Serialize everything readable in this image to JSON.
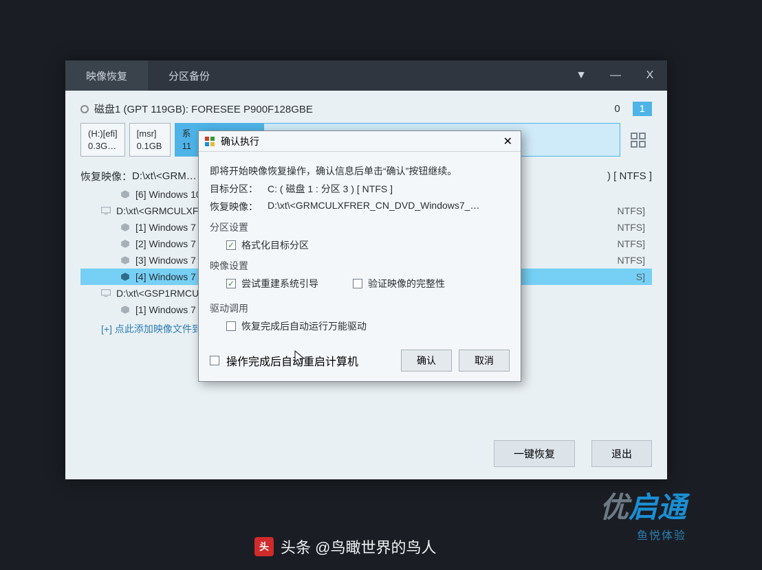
{
  "tabs": {
    "restore": "映像恢复",
    "backup": "分区备份"
  },
  "titlebar": {
    "dropdown": "▼",
    "minimize": "—",
    "close": "X"
  },
  "disk": {
    "label": "磁盘1 (GPT 119GB): FORESEE P900F128GBE",
    "num0": "0",
    "num1": "1"
  },
  "partitions": {
    "p1_line1": "(H:)[efi]",
    "p1_line2": "0.3G…",
    "p2_line1": "[msr]",
    "p2_line2": "0.1GB",
    "p3_line1": "系",
    "p3_line2": "11"
  },
  "restore_label": "恢复映像：",
  "restore_path_trail": ") [ NTFS ]",
  "tree": {
    "root1": "D:\\xt\\<GRM…",
    "r1_c1": "[6] Windows 10",
    "r1_c1_trail": "",
    "root2": "D:\\xt\\<GRMCULXFRER…",
    "r2_c1": "[1] Windows 7",
    "r2_c1_trail": "NTFS]",
    "r2_c2": "[2] Windows 7",
    "r2_c2_trail": "NTFS]",
    "r2_c3": "[3] Windows 7",
    "r2_c3_trail": "NTFS]",
    "r2_c4": "[4] Windows 7",
    "r2_c4_trail": "S]",
    "root3": "D:\\xt\\<GSP1RMCUL…",
    "r3_c1": "[1] Windows 7",
    "addlink": "[+] 点此添加映像文件到列表"
  },
  "footer": {
    "restore_btn": "一键恢复",
    "exit_btn": "退出"
  },
  "dialog": {
    "title": "确认执行",
    "intro": "即将开始映像恢复操作，确认信息后单击“确认”按钮继续。",
    "target_k": "目标分区：",
    "target_v": "C: ( 磁盘 1 : 分区 3 ) [ NTFS ]",
    "image_k": "恢复映像：",
    "image_v": "D:\\xt\\<GRMCULXFRER_CN_DVD_Windows7_…",
    "sect_part": "分区设置",
    "chk_format": "格式化目标分区",
    "sect_img": "映像设置",
    "chk_boot": "尝试重建系统引导",
    "chk_verify": "验证映像的完整性",
    "sect_drv": "驱动调用",
    "chk_driver": "恢复完成后自动运行万能驱动",
    "chk_reboot": "操作完成后自动重启计算机",
    "ok": "确认",
    "cancel": "取消"
  },
  "brand": {
    "b1": "优",
    "b2": "启通",
    "sub": "鱼悦体验"
  },
  "watermark": {
    "logo": "头",
    "text": "头条 @鸟瞰世界的鸟人"
  }
}
